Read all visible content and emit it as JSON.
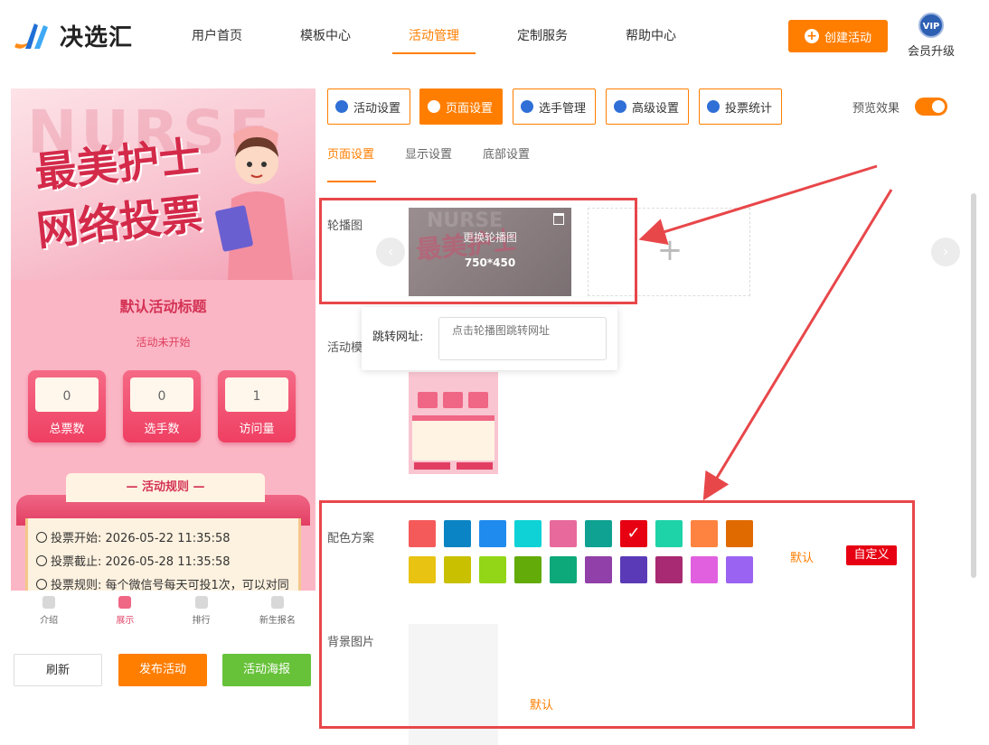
{
  "brand": {
    "name": "决选汇"
  },
  "nav": [
    {
      "label": "用户首页",
      "active": false
    },
    {
      "label": "模板中心",
      "active": false
    },
    {
      "label": "活动管理",
      "active": true
    },
    {
      "label": "定制服务",
      "active": false
    },
    {
      "label": "帮助中心",
      "active": false
    }
  ],
  "header": {
    "create_label": "创建活动",
    "vip_badge": "VIP",
    "vip_label": "会员升级"
  },
  "preview": {
    "banner_line1": "最美护士",
    "banner_line2": "网络投票",
    "banner_bg_text": "NURSE",
    "title": "默认活动标题",
    "status": "活动未开始",
    "stats": [
      {
        "value": "0",
        "label": "总票数"
      },
      {
        "value": "0",
        "label": "选手数"
      },
      {
        "value": "1",
        "label": "访问量"
      }
    ],
    "rules_title": "— 活动规则 —",
    "rules": [
      "投票开始: 2026-05-22 11:35:58",
      "投票截止: 2026-05-28 11:35:58",
      "投票规则: 每个微信号每天可投1次，可以对同"
    ],
    "tabbar": [
      {
        "label": "介绍",
        "active": false
      },
      {
        "label": "展示",
        "active": true
      },
      {
        "label": "排行",
        "active": false
      },
      {
        "label": "新生报名",
        "active": false
      }
    ]
  },
  "actions": {
    "refresh": "刷新",
    "publish": "发布活动",
    "poster": "活动海报"
  },
  "toolbar": [
    {
      "label": "活动设置",
      "active": false,
      "icon": "star-icon"
    },
    {
      "label": "页面设置",
      "active": true,
      "icon": "gear-icon"
    },
    {
      "label": "选手管理",
      "active": false,
      "icon": "users-icon"
    },
    {
      "label": "高级设置",
      "active": false,
      "icon": "sliders-icon"
    },
    {
      "label": "投票统计",
      "active": false,
      "icon": "bar-chart-icon"
    }
  ],
  "preview_toggle": {
    "label": "预览效果",
    "on": true
  },
  "subtabs": [
    {
      "label": "页面设置",
      "active": true
    },
    {
      "label": "显示设置",
      "active": false
    },
    {
      "label": "底部设置",
      "active": false
    }
  ],
  "carousel": {
    "label": "轮播图",
    "replace_text": "更换轮播图",
    "size_text": "750*450",
    "add_symbol": "+",
    "prev_icon": "‹",
    "next_icon": "›"
  },
  "popup": {
    "label": "跳转网址:",
    "placeholder": "点击轮播图跳转网址"
  },
  "template_label": "活动模",
  "color_scheme": {
    "label": "配色方案",
    "swatches": [
      "#f55a5a",
      "#0a84c4",
      "#1f8bef",
      "#0fd2d6",
      "#e8699b",
      "#0fa192",
      "#e60012",
      "#1fd3a8",
      "#ff8340",
      "#e06a00",
      "#e8c312",
      "#c9c000",
      "#92d617",
      "#63ab08",
      "#0ea97a",
      "#9040a8",
      "#5b3ab8",
      "#a82a72",
      "#e160e0",
      "#9b63f2"
    ],
    "selected": 6,
    "default_label": "默认",
    "custom_label": "自定义"
  },
  "background": {
    "label": "背景图片",
    "default_label": "默认"
  },
  "colors": {
    "accent": "#ff7e00",
    "annotation": "#e8474a"
  }
}
